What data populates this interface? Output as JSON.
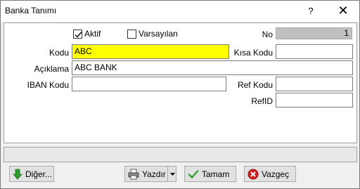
{
  "window": {
    "title": "Banka Tanımı"
  },
  "titlebar": {
    "help": "?",
    "close": "✕"
  },
  "form": {
    "aktif_label": "Aktif",
    "aktif_checked": true,
    "varsayilan_label": "Varsayılan",
    "varsayilan_checked": false,
    "no_label": "No",
    "no_value": "1",
    "kodu_label": "Kodu",
    "kodu_value": "ABC",
    "kisa_kodu_label": "Kısa Kodu",
    "kisa_kodu_value": "",
    "aciklama_label": "Açıklama",
    "aciklama_value": "ABC BANK",
    "iban_label": "IBAN Kodu",
    "iban_value": "",
    "ref_kodu_label": "Ref Kodu",
    "ref_kodu_value": "",
    "refid_label": "RefID",
    "refid_value": ""
  },
  "buttons": {
    "diger": "Diğer...",
    "yazdir": "Yazdır",
    "tamam": "Tamam",
    "vazgec": "Vazgeç"
  },
  "colors": {
    "highlight_field": "#ffff00",
    "readonly_field": "#c0c0c0"
  }
}
